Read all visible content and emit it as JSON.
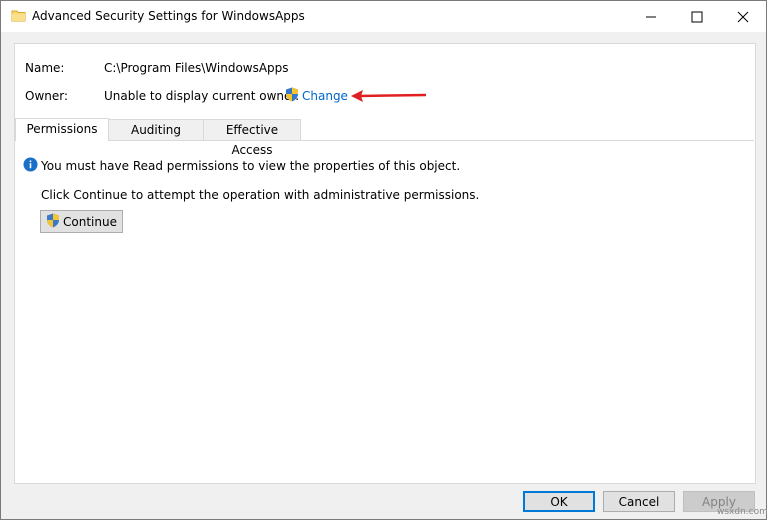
{
  "window": {
    "title": "Advanced Security Settings for WindowsApps",
    "controls": [
      "minimize",
      "maximize",
      "close"
    ]
  },
  "info": {
    "name_label": "Name:",
    "name_value": "C:\\Program Files\\WindowsApps",
    "owner_label": "Owner:",
    "owner_value": "Unable to display current owner.",
    "change_link": "Change"
  },
  "tabs": [
    {
      "label": "Permissions",
      "active": true
    },
    {
      "label": "Auditing",
      "active": false
    },
    {
      "label": "Effective Access",
      "active": false
    }
  ],
  "permissions": {
    "message": "You must have Read permissions to view the properties of this object.",
    "instruction": "Click Continue to attempt the operation with administrative permissions.",
    "continue_label": "Continue"
  },
  "footer": {
    "ok_label": "OK",
    "cancel_label": "Cancel",
    "apply_label": "Apply",
    "apply_disabled": true
  },
  "watermark": "wsxdn.com",
  "colors": {
    "link": "#0066cc",
    "arrow": "#e02020",
    "focus_border": "#0078d7",
    "info_icon": "#1a6fc7"
  }
}
